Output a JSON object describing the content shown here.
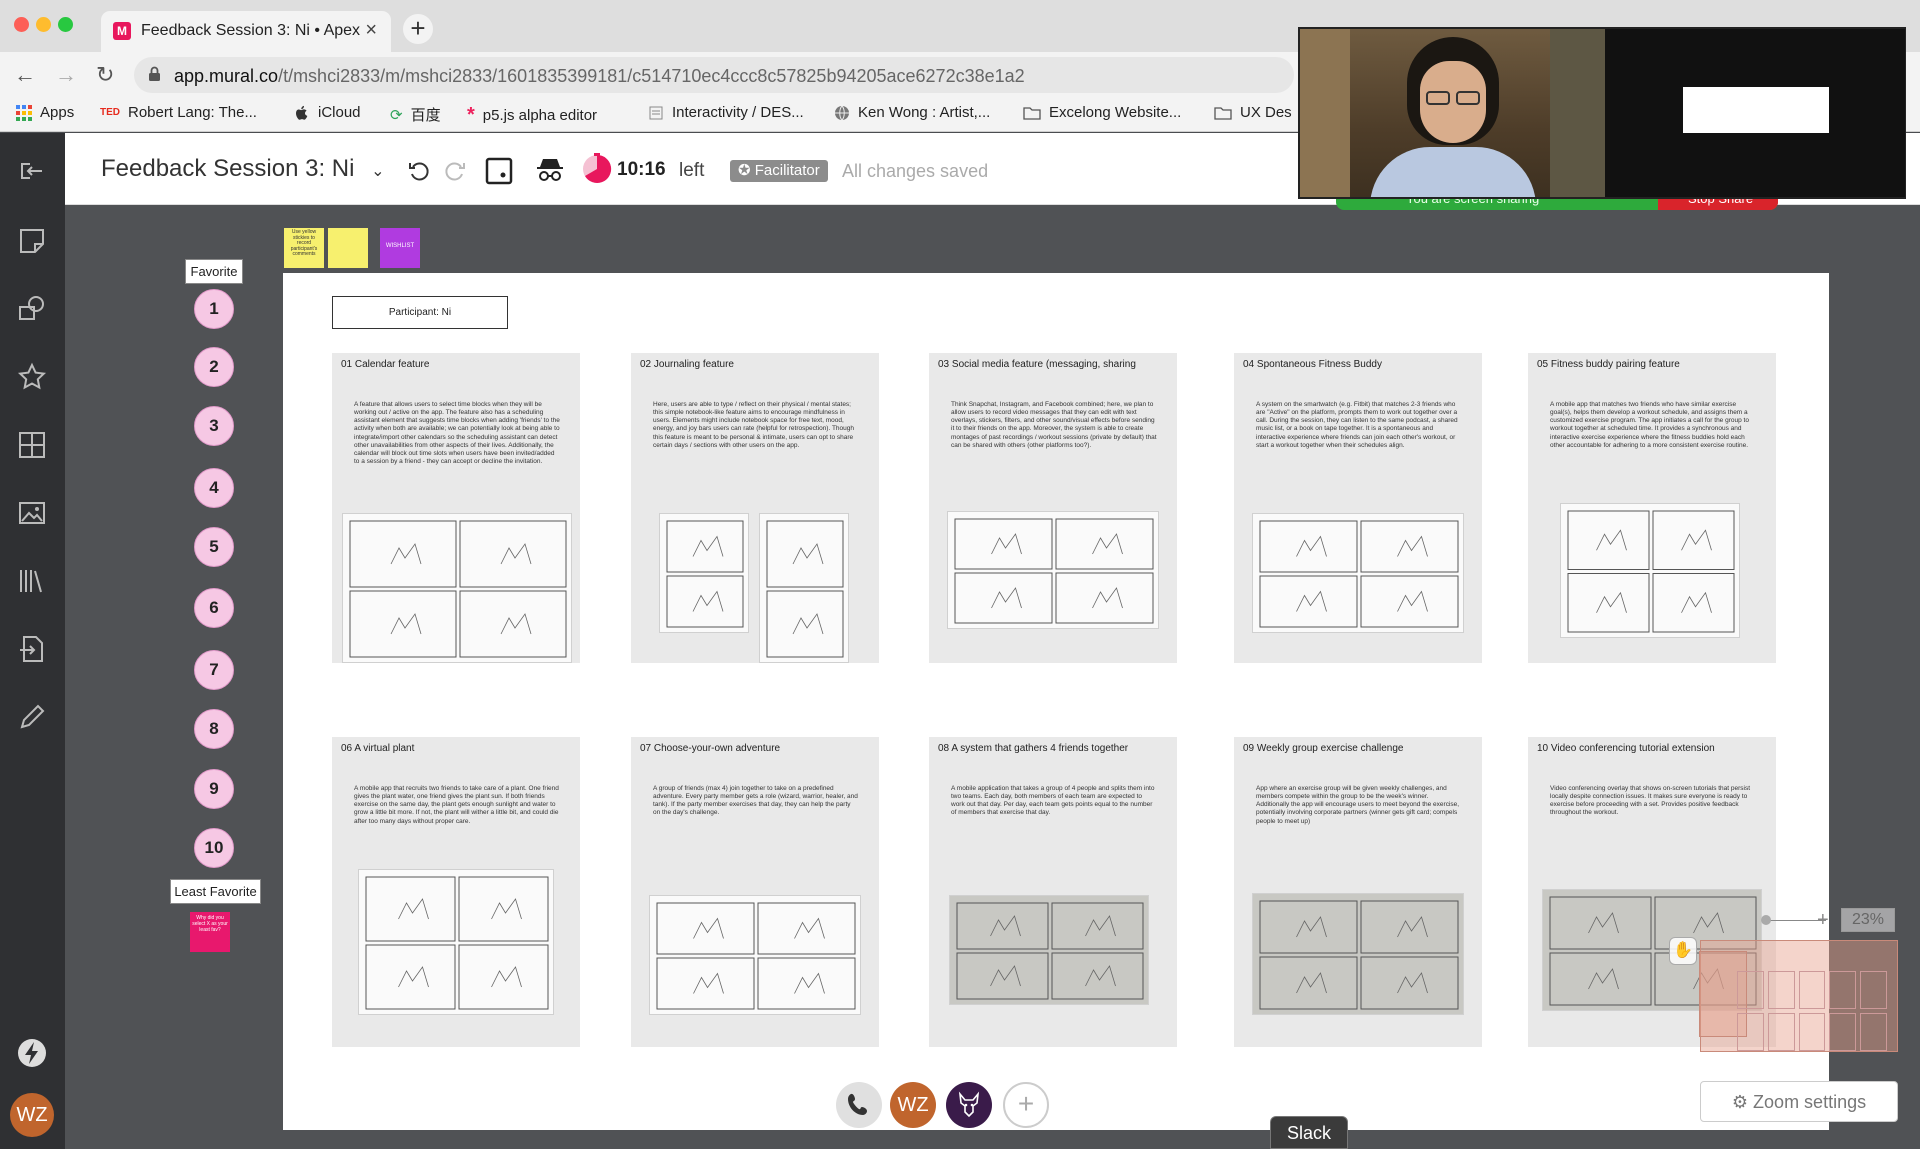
{
  "browser": {
    "tab_title": "Feedback Session 3: Ni • Apex",
    "tab_favicon_letter": "M",
    "url_host": "app.mural.co",
    "url_path": "/t/mshci2833/m/mshci2833/1601835399181/c514710ec4ccc8c57825b94205ace6272c38e1a2",
    "bookmarks": [
      {
        "label": "Apps",
        "icon": "apps-grid-icon"
      },
      {
        "label": "Robert Lang: The...",
        "icon": "ted-icon"
      },
      {
        "label": "iCloud",
        "icon": "apple-icon"
      },
      {
        "label": "百度",
        "icon": "baidu-icon"
      },
      {
        "label": "p5.js alpha editor",
        "icon": "p5-icon"
      },
      {
        "label": "Interactivity / DES...",
        "icon": "page-icon"
      },
      {
        "label": "Ken Wong : Artist,...",
        "icon": "globe-icon"
      },
      {
        "label": "Excelong Website...",
        "icon": "folder-icon"
      },
      {
        "label": "UX Des",
        "icon": "folder-icon"
      }
    ]
  },
  "app": {
    "mural_title": "Feedback Session 3: Ni",
    "timer": "10:16",
    "timer_suffix": "left",
    "facilitator_label": "Facilitator",
    "save_status": "All changes saved",
    "avatar_initials": "WZ"
  },
  "board": {
    "participant_label": "Participant: Ni",
    "favorite_label": "Favorite",
    "least_label": "Least Favorite",
    "ranks": [
      "1",
      "2",
      "3",
      "4",
      "5",
      "6",
      "7",
      "8",
      "9",
      "10"
    ],
    "stickies": [
      {
        "text": "Use yellow stickies to record participant's comments",
        "color": "#f7f06e"
      },
      {
        "text": "",
        "color": "#f7f06e"
      },
      {
        "text": "WISHLIST",
        "color": "#b03be0"
      }
    ],
    "pink_note": "Why did you select X as your least fav?",
    "cards": [
      {
        "title": "01 Calendar feature",
        "desc": "A feature that allows users to select time blocks when they will be working out / active on the app. The feature also has a scheduling assistant element that suggests time blocks when adding 'friends' to the activity when both are available; we can potentially look at being able to integrate/import other calendars so the scheduling assistant can detect other unavailabilities from other aspects of their lives. Additionally, the calendar will block out time slots when users have been invited/added to a session by a friend - they can accept or decline the invitation."
      },
      {
        "title": "02 Journaling feature",
        "desc": "Here, users are able to type / reflect on their physical / mental states; this simple notebook-like feature aims to encourage mindfulness in users. Elements might include notebook space for free text, mood, energy, and joy bars users can rate (helpful for retrospection). Though this feature is meant to be personal & intimate, users can opt to share certain days / sections with other users on the app."
      },
      {
        "title": "03 Social media feature (messaging, sharing",
        "desc": "Think Snapchat, Instagram, and Facebook combined; here, we plan to allow users to record video messages that they can edit with text overlays, stickers, filters, and other sound/visual effects before sending it to their friends on the app. Moreover, the system is able to create montages of past recordings / workout sessions (private by default) that can be shared with others (other platforms too?)."
      },
      {
        "title": "04 Spontaneous Fitness Buddy",
        "desc": "A system on the smartwatch (e.g. Fitbit) that matches 2-3 friends who are \"Active\" on the platform, prompts them to work out together over a call. During the session, they can listen to the same podcast, a shared music list, or a book on tape together. It is a spontaneous and interactive experience where friends can join each other's workout, or start a workout together when their schedules align."
      },
      {
        "title": "05 Fitness buddy pairing feature",
        "desc": "A mobile app that matches two friends who have similar exercise goal(s), helps them develop a workout schedule, and assigns them a customized exercise program. The app initiates a call for the group to workout together at scheduled time. It provides a synchronous and interactive exercise experience where the fitness buddies hold each other accountable for adhering to a more consistent exercise routine."
      },
      {
        "title": "06 A virtual plant",
        "desc": "A mobile app that recruits two friends to take care of a plant. One friend gives the plant water, one friend gives the plant sun. If both friends exercise on the same day, the plant gets enough sunlight and water to grow a little bit more. If not, the plant will wither a little bit, and could die after too many days without proper care."
      },
      {
        "title": "07 Choose-your-own adventure",
        "desc": "A group of friends (max 4) join together to take on a predefined adventure. Every party member gets a role (wizard, warrior, healer, and tank). If the party member exercises that day, they can help the party on the day's challenge."
      },
      {
        "title": "08 A system that gathers 4 friends together",
        "desc": "A mobile application that takes a group of 4 people and splits them into two teams. Each day, both members of each team are expected to work out that day. Per day, each team gets points equal to the number of members that exercise that day."
      },
      {
        "title": "09 Weekly group exercise challenge",
        "desc": "App where an exercise group will be given weekly challenges, and members compete within the group to be the week's winner. Additionally the app will encourage users to meet beyond the exercise, potentially involving corporate partners (winner gets gift card; compels people to meet up)"
      },
      {
        "title": "10 Video conferencing tutorial extension",
        "desc": "Video conferencing overlay that shows on-screen tutorials that persist locally despite connection issues. It makes sure everyone is ready to exercise before proceeding with a set. Provides positive feedback throughout the workout."
      }
    ]
  },
  "overlay": {
    "screen_sharing_text": "You are screen sharing",
    "stop_share_label": "Stop Share",
    "zoom_percent": "23%",
    "zoom_settings_label": "Zoom settings",
    "slack_label": "Slack",
    "call_avatar_initials": "WZ"
  },
  "colors": {
    "mural_pink": "#e8175d",
    "rank_pink": "#f6c8e4",
    "rail_dark": "#2f3033",
    "canvas_bg": "#505255",
    "avatar_orange": "#c0652d"
  }
}
